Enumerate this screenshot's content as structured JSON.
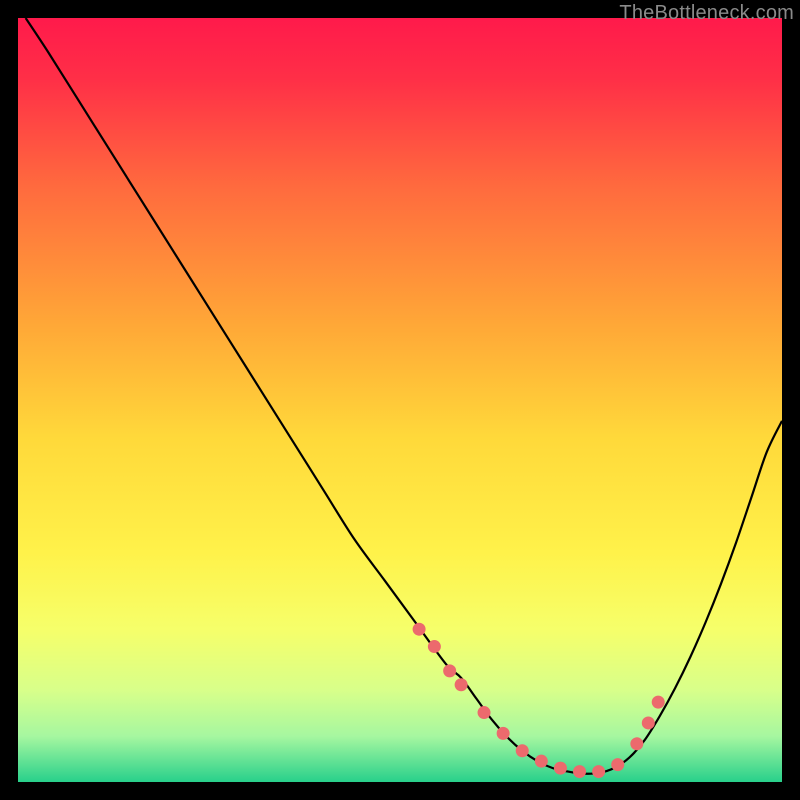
{
  "watermark": "TheBottleneck.com",
  "chart_data": {
    "type": "line",
    "title": "",
    "xlabel": "",
    "ylabel": "",
    "xlim": [
      0,
      100
    ],
    "ylim": [
      0,
      110
    ],
    "grid": false,
    "legend": false,
    "background_gradient": {
      "type": "vertical",
      "stops": [
        {
          "pct": 0.0,
          "color": "#ff1a4b"
        },
        {
          "pct": 0.08,
          "color": "#ff2f47"
        },
        {
          "pct": 0.22,
          "color": "#ff6a3e"
        },
        {
          "pct": 0.4,
          "color": "#ffa737"
        },
        {
          "pct": 0.55,
          "color": "#ffd93a"
        },
        {
          "pct": 0.7,
          "color": "#fff24a"
        },
        {
          "pct": 0.8,
          "color": "#f6ff6a"
        },
        {
          "pct": 0.88,
          "color": "#d8ff8a"
        },
        {
          "pct": 0.94,
          "color": "#a6f7a0"
        },
        {
          "pct": 1.0,
          "color": "#28d08b"
        }
      ]
    },
    "series": [
      {
        "name": "bottleneck-curve",
        "color": "#000000",
        "x": [
          1,
          4,
          8,
          12,
          16,
          20,
          24,
          28,
          32,
          36,
          40,
          44,
          48,
          52,
          56,
          58,
          60,
          62,
          64,
          66,
          68,
          70,
          72,
          74,
          76,
          78,
          80,
          82,
          84,
          86,
          88,
          90,
          92,
          94,
          96,
          98,
          100
        ],
        "y": [
          110,
          105,
          98,
          91,
          84,
          77,
          70,
          63,
          56,
          49,
          42,
          35,
          29,
          23,
          17,
          15,
          12,
          9,
          6.5,
          4.5,
          3,
          2,
          1.5,
          1.2,
          1.3,
          2,
          3.5,
          6,
          9.5,
          13.5,
          18,
          23,
          28.5,
          34.5,
          41,
          47.5,
          52
        ]
      }
    ],
    "markers": {
      "name": "highlighted-points",
      "color": "#ec6a6d",
      "radius": 6.5,
      "x": [
        52.5,
        54.5,
        56.5,
        58.0,
        61.0,
        63.5,
        66.0,
        68.5,
        71.0,
        73.5,
        76.0,
        78.5,
        81.0,
        82.5,
        83.8
      ],
      "y": [
        22.0,
        19.5,
        16.0,
        14.0,
        10.0,
        7.0,
        4.5,
        3.0,
        2.0,
        1.5,
        1.5,
        2.5,
        5.5,
        8.5,
        11.5
      ]
    }
  }
}
